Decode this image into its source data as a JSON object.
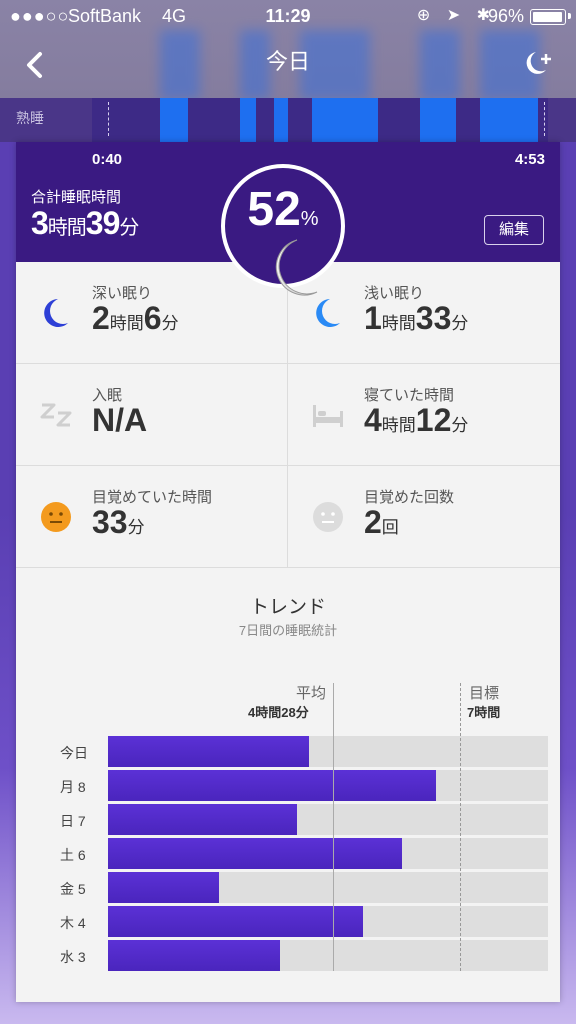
{
  "status_bar": {
    "signal": "●●●○○",
    "carrier": "SoftBank",
    "network": "4G",
    "time": "11:29",
    "icons": "⊕ ➤ ✱",
    "battery": "96%"
  },
  "nav": {
    "title": "今日",
    "back_icon": "chevron-left-icon",
    "add_icon": "moon-plus-icon"
  },
  "sleep_band": {
    "label": "熟睡",
    "start_time": "0:40",
    "end_time": "4:53"
  },
  "summary": {
    "total_label": "合計睡眠時間",
    "total_hours": "3",
    "hours_unit": "時間",
    "total_minutes": "39",
    "minutes_unit": "分",
    "score": "52",
    "score_unit": "%",
    "edit_label": "編集"
  },
  "stats": {
    "deep": {
      "label": "深い眠り",
      "h": "2",
      "hu": "時間",
      "m": "6",
      "mu": "分",
      "icon": "moon-icon"
    },
    "light": {
      "label": "浅い眠り",
      "h": "1",
      "hu": "時間",
      "m": "33",
      "mu": "分",
      "icon": "moon-icon"
    },
    "fall_asleep": {
      "label": "入眠",
      "value": "N/A",
      "icon": "zz-icon"
    },
    "in_bed": {
      "label": "寝ていた時間",
      "h": "4",
      "hu": "時間",
      "m": "12",
      "mu": "分",
      "icon": "bed-icon"
    },
    "awake": {
      "label": "目覚めていた時間",
      "m": "33",
      "mu": "分",
      "icon": "neutral-face-icon"
    },
    "awakenings": {
      "label": "目覚めた回数",
      "count": "2",
      "cu": "回",
      "icon": "face-icon"
    }
  },
  "trend": {
    "title": "トレンド",
    "subtitle": "7日間の睡眠統計",
    "avg_label": "平均",
    "avg_value": "4時間28分",
    "goal_label": "目標",
    "goal_value": "7時間",
    "days": [
      {
        "label": "今日",
        "value_h": 3.65
      },
      {
        "label": "月 8",
        "value_h": 5.97
      },
      {
        "label": "日 7",
        "value_h": 3.43
      },
      {
        "label": "土 6",
        "value_h": 5.35
      },
      {
        "label": "金 5",
        "value_h": 2.02
      },
      {
        "label": "木 4",
        "value_h": 4.63
      },
      {
        "label": "水 3",
        "value_h": 3.13
      }
    ]
  },
  "colors": {
    "header": "#3a1a82",
    "bar": "#5b31d6",
    "light_sleep": "#1e6ff0",
    "awake_icon": "#f39a1e"
  }
}
